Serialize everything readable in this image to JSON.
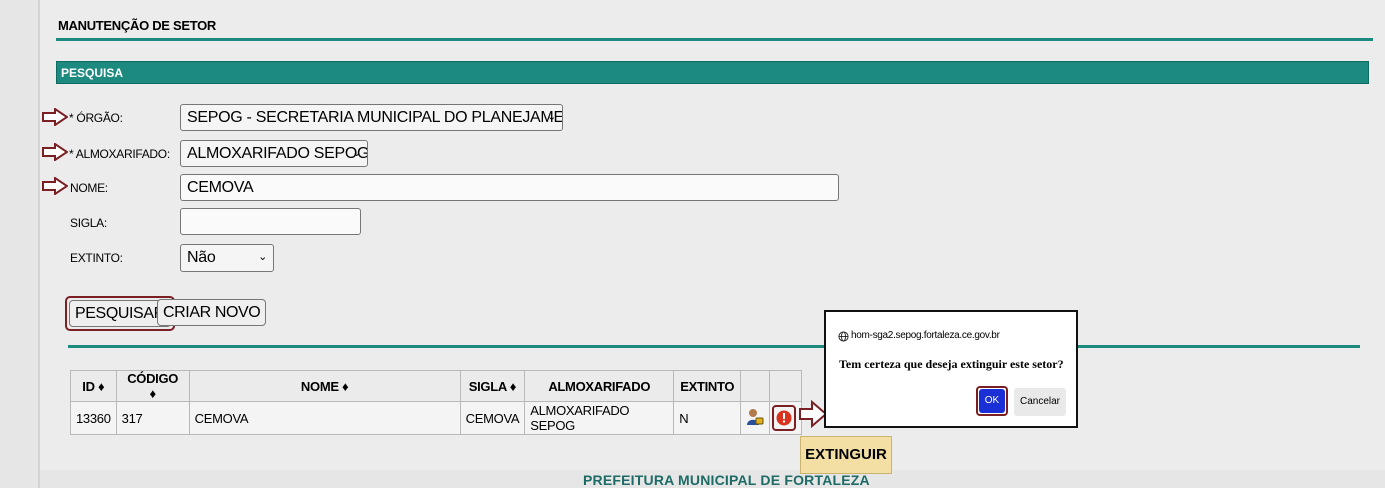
{
  "page": {
    "title": "MANUTENÇÃO DE SETOR",
    "footer": "PREFEITURA MUNICIPAL DE FORTALEZA"
  },
  "search": {
    "section_title": "PESQUISA",
    "orgao": {
      "label": "* ÓRGÃO:",
      "value": "SEPOG - SECRETARIA MUNICIPAL DO PLANEJAMENTO,"
    },
    "almoxarifado": {
      "label": "* ALMOXARIFADO:",
      "value": "ALMOXARIFADO SEPOG"
    },
    "nome": {
      "label": "NOME:",
      "value": "CEMOVA"
    },
    "sigla": {
      "label": "SIGLA:",
      "value": ""
    },
    "extinto": {
      "label": "EXTINTO:",
      "value": "Não"
    },
    "search_button": "PESQUISAR",
    "new_button": "CRIAR NOVO"
  },
  "table": {
    "headers": [
      "ID ♦",
      "CÓDIGO ♦",
      "NOME ♦",
      "SIGLA ♦",
      "ALMOXARIFADO",
      "EXTINTO"
    ],
    "rows": [
      {
        "id": "13360",
        "codigo": "317",
        "nome": "CEMOVA",
        "sigla": "CEMOVA",
        "almoxarifado": "ALMOXARIFADO SEPOG",
        "extinto": "N"
      }
    ]
  },
  "dialog": {
    "origin": "hom-sga2.sepog.fortaleza.ce.gov.br",
    "message": "Tem certeza que deseja extinguir este setor?",
    "ok": "OK",
    "cancel": "Cancelar"
  },
  "tooltip": "EXTINGUIR",
  "colors": {
    "accent": "#1d8a80",
    "highlight": "#7a1f24",
    "ok_button": "#1a2fd6",
    "tooltip_bg": "#f3dfa4"
  },
  "icons": [
    "user-lock-icon",
    "extinguish-icon",
    "globe-icon",
    "arrow-pointer-icon"
  ]
}
